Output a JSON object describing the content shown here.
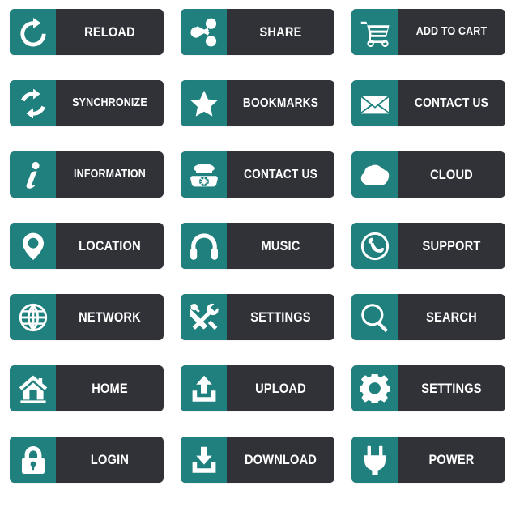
{
  "page": {
    "title": "Flat Icon Buttons Set",
    "background_color": "#ffffff",
    "columns": 3,
    "rows": 7,
    "total_buttons": 21
  },
  "theme": {
    "icon_panel_color": "#1f807e",
    "label_panel_color": "#303238",
    "glyph_color": "#ffffff",
    "label_color": "#ffffff",
    "corner_radius_px": 6
  },
  "buttons": [
    {
      "label": "RELOAD",
      "icon": "reload-icon",
      "size": ""
    },
    {
      "label": "SHARE",
      "icon": "share-icon",
      "size": ""
    },
    {
      "label": "ADD TO CART",
      "icon": "cart-icon",
      "size": "sz-xs"
    },
    {
      "label": "SYNCHRONIZE",
      "icon": "synchronize-icon",
      "size": "sz-xs"
    },
    {
      "label": "BOOKMARKS",
      "icon": "star-icon",
      "size": "sz-s"
    },
    {
      "label": "CONTACT US",
      "icon": "envelope-icon",
      "size": "sz-s"
    },
    {
      "label": "INFORMATION",
      "icon": "info-icon",
      "size": "sz-xs"
    },
    {
      "label": "CONTACT US",
      "icon": "telephone-icon",
      "size": "sz-s"
    },
    {
      "label": "CLOUD",
      "icon": "cloud-icon",
      "size": ""
    },
    {
      "label": "LOCATION",
      "icon": "map-pin-icon",
      "size": ""
    },
    {
      "label": "MUSIC",
      "icon": "headphones-icon",
      "size": ""
    },
    {
      "label": "SUPPORT",
      "icon": "phone-ring-icon",
      "size": ""
    },
    {
      "label": "NETWORK",
      "icon": "globe-icon",
      "size": ""
    },
    {
      "label": "SETTINGS",
      "icon": "tools-icon",
      "size": ""
    },
    {
      "label": "SEARCH",
      "icon": "magnifier-icon",
      "size": ""
    },
    {
      "label": "HOME",
      "icon": "home-icon",
      "size": ""
    },
    {
      "label": "UPLOAD",
      "icon": "upload-icon",
      "size": ""
    },
    {
      "label": "SETTINGS",
      "icon": "gear-icon",
      "size": ""
    },
    {
      "label": "LOGIN",
      "icon": "lock-icon",
      "size": ""
    },
    {
      "label": "DOWNLOAD",
      "icon": "download-icon",
      "size": ""
    },
    {
      "label": "POWER",
      "icon": "plug-icon",
      "size": ""
    }
  ]
}
